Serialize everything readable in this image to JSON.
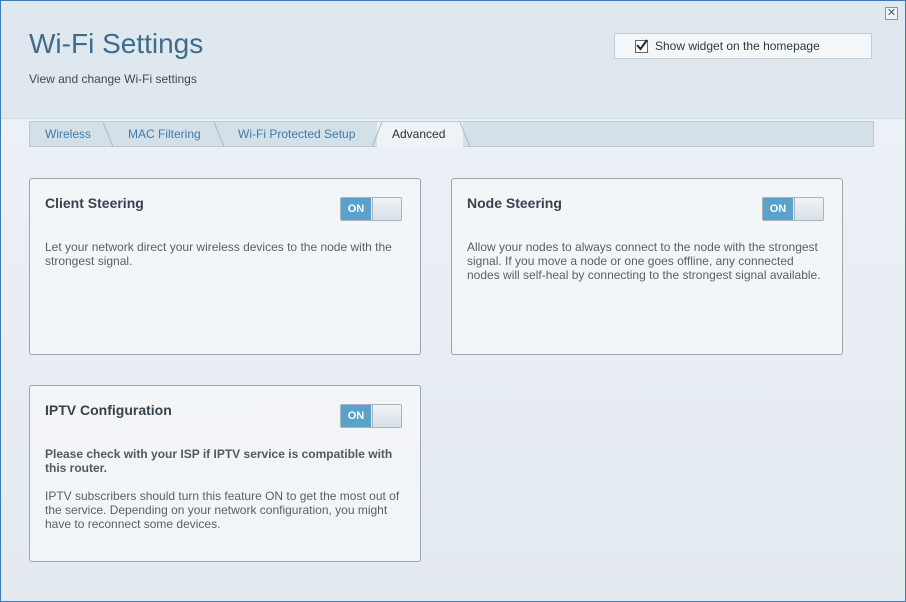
{
  "header": {
    "title": "Wi-Fi Settings",
    "subtitle": "View and change Wi-Fi settings",
    "close_icon": "close-icon",
    "widget_checkbox": {
      "label": "Show widget on the homepage",
      "checked": true
    }
  },
  "tabs": [
    {
      "label": "Wireless",
      "active": false
    },
    {
      "label": "MAC Filtering",
      "active": false
    },
    {
      "label": "Wi-Fi Protected Setup",
      "active": false
    },
    {
      "label": "Advanced",
      "active": true
    }
  ],
  "cards": {
    "client_steering": {
      "title": "Client Steering",
      "toggle": "ON",
      "description": "Let your network direct your wireless devices to the node with the strongest signal."
    },
    "node_steering": {
      "title": "Node Steering",
      "toggle": "ON",
      "description": "Allow your nodes to always connect to the node with the strongest signal. If you move a node or one goes offline, any connected nodes will self-heal by connecting to the strongest signal available."
    },
    "iptv": {
      "title": "IPTV Configuration",
      "toggle": "ON",
      "warning": "Please check with your ISP if IPTV service is compatible with this router.",
      "description": "IPTV subscribers should turn this feature ON to get the most out of the service. Depending on your network configuration, you might have to reconnect some devices."
    }
  },
  "colors": {
    "accent": "#5aa1cc",
    "title": "#3d6c8c",
    "tab_link": "#3d7cab"
  }
}
